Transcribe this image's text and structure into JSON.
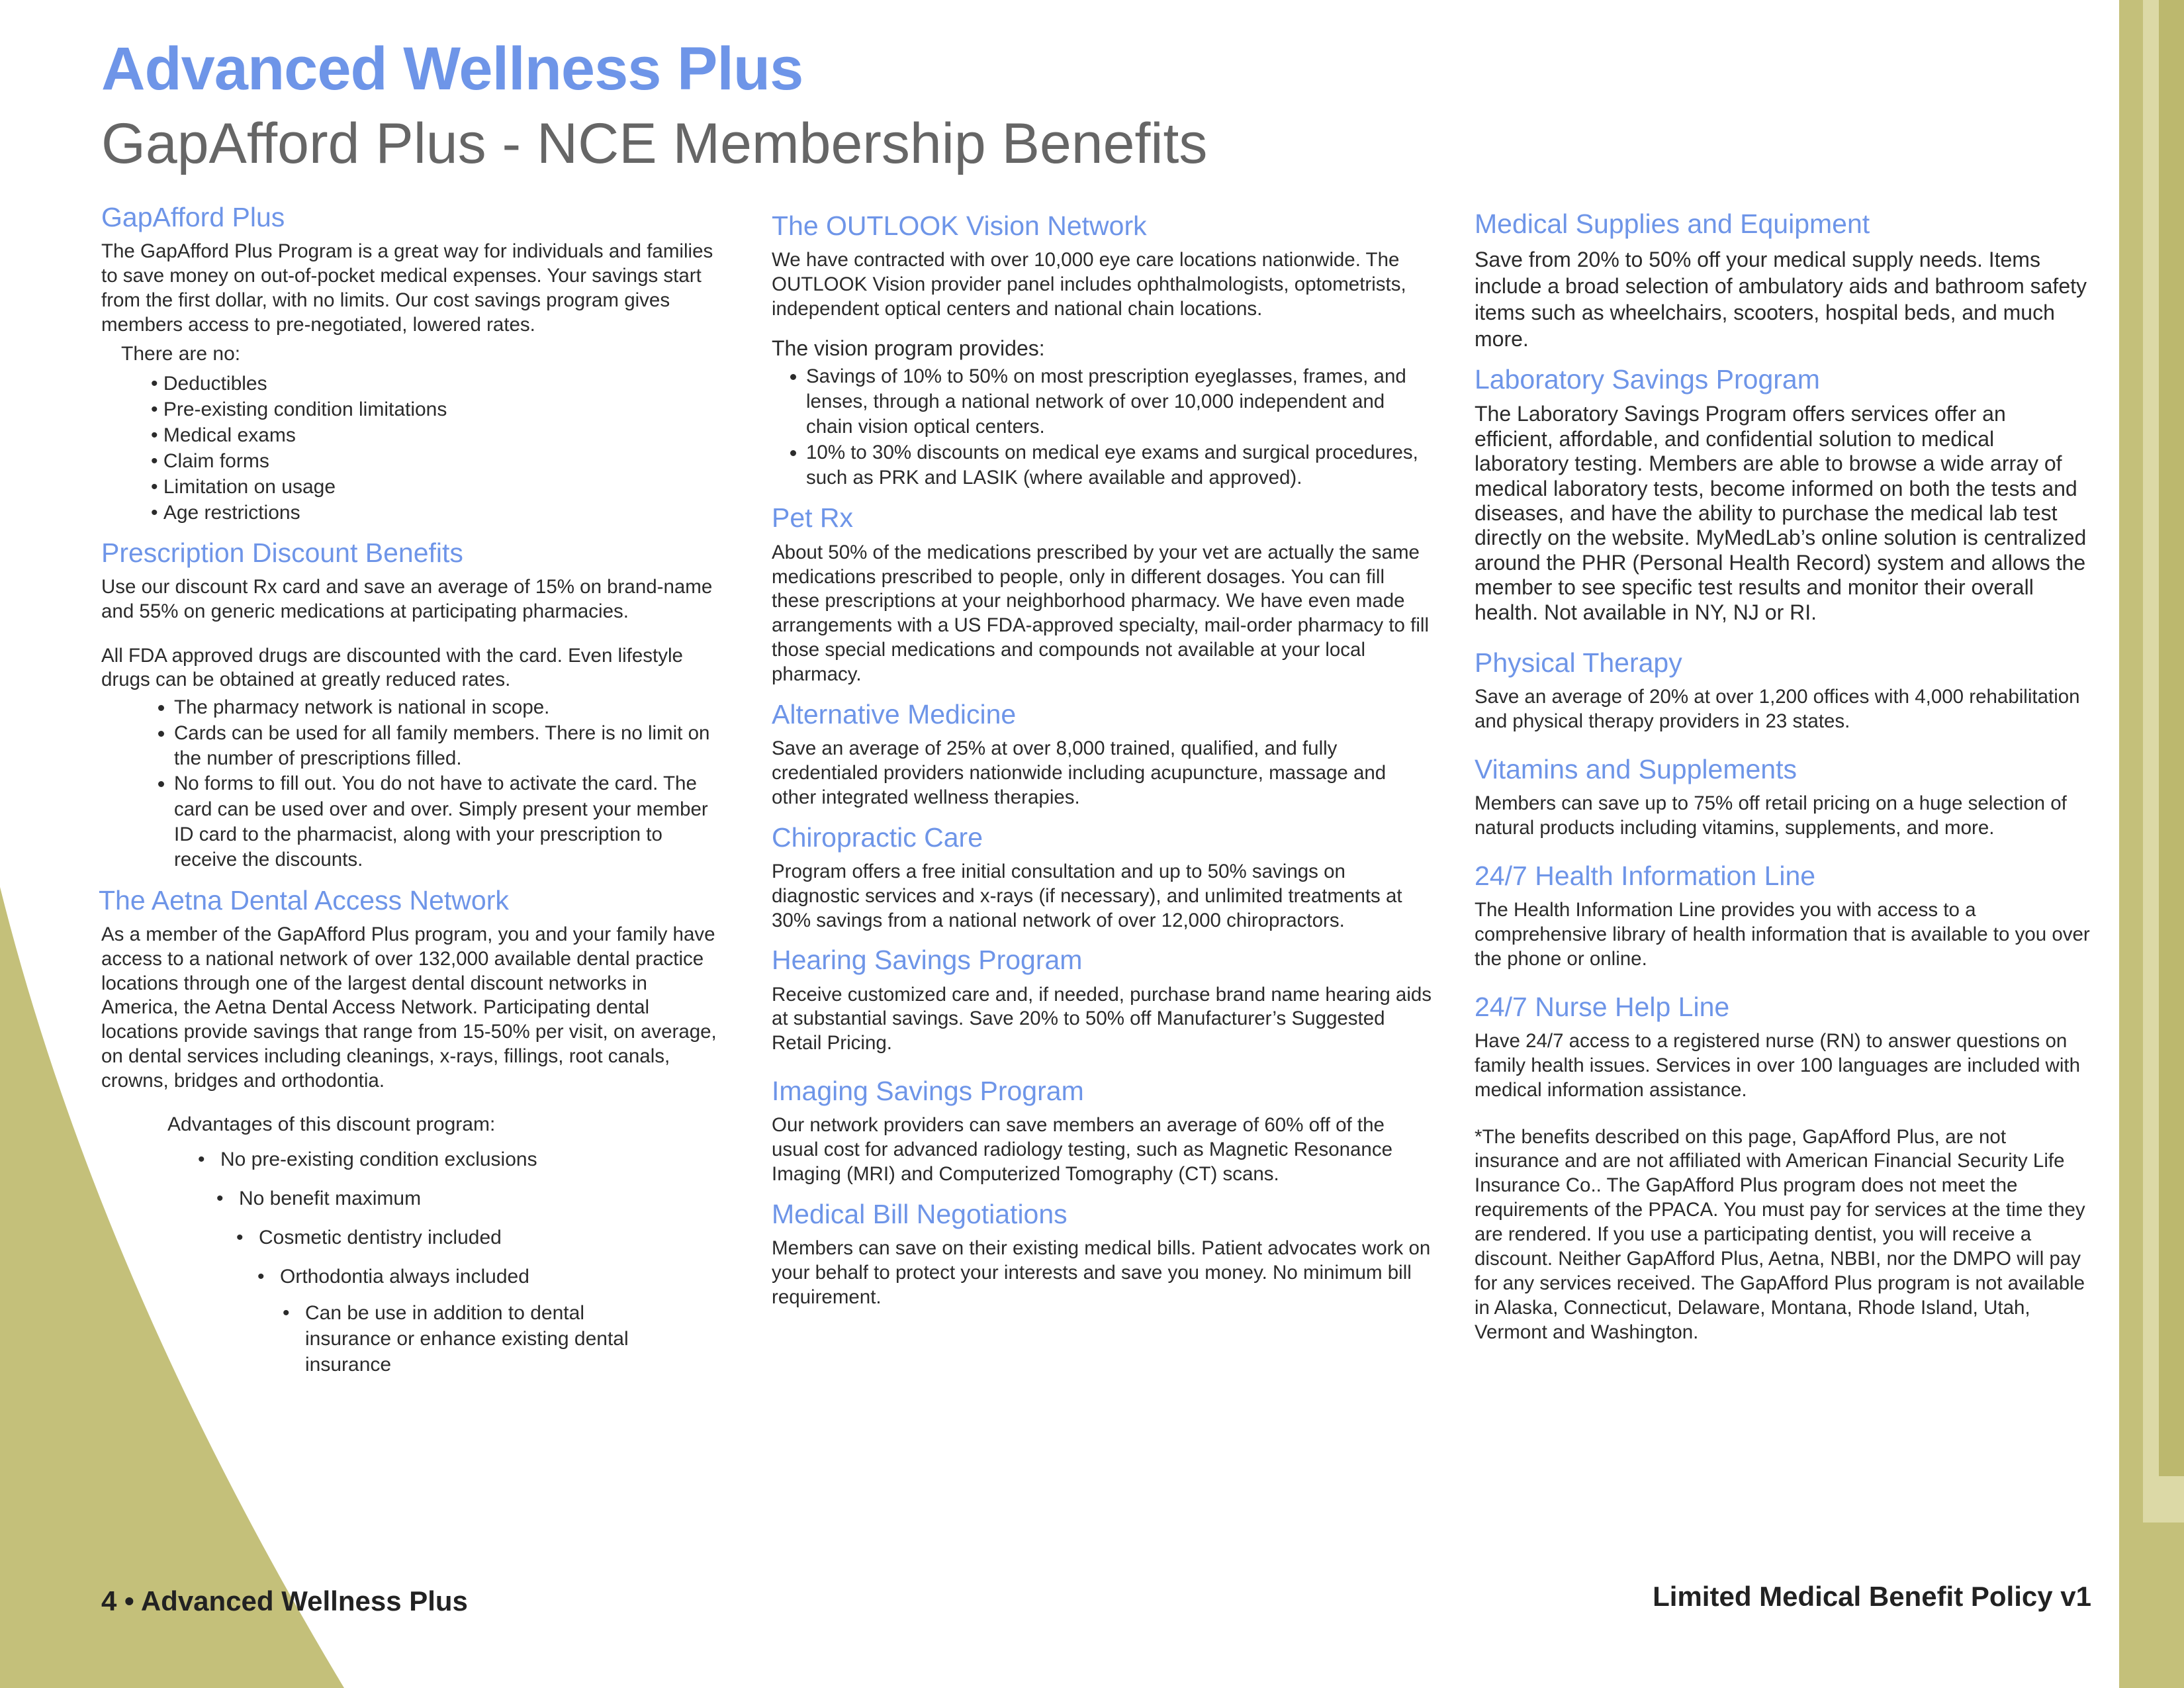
{
  "header": {
    "brand": "Advanced Wellness Plus",
    "title": "GapAfford Plus - NCE Membership Benefits"
  },
  "col1": {
    "gapafford": {
      "heading": "GapAfford Plus",
      "body": "The GapAfford Plus Program is a great way for individuals and families to save money on out-of-pocket medical expenses. Your savings start from the first dollar, with no limits. Our cost savings program gives members access to pre-negotiated, lowered rates.",
      "no_intro": "There are no:",
      "no_items": [
        "Deductibles",
        "Pre-existing condition limitations",
        "Medical exams",
        "Claim forms",
        "Limitation on usage",
        "Age restrictions"
      ]
    },
    "rx": {
      "heading": "Prescription Discount Benefits",
      "body1": "Use our discount Rx card and save an average of 15% on brand-name and 55% on generic medications at participating pharmacies.",
      "body2": "All FDA approved drugs are discounted with the card. Even lifestyle drugs can be obtained at greatly reduced rates.",
      "items": [
        "The pharmacy network is national in scope.",
        "Cards can be used for all family members. There is no limit on the number of prescriptions filled.",
        "No forms to fill out. You do not have to activate the card. The card can be used over and over. Simply present your member ID card to the pharmacist, along with your prescription to receive the discounts."
      ]
    },
    "dental": {
      "heading": "The Aetna Dental Access Network",
      "body": "As a member of the GapAfford Plus program, you and your family have access to a national network of over 132,000 available dental practice locations through one of the largest dental discount networks in America, the Aetna Dental Access Network. Participating dental locations provide savings that range from 15-50% per visit, on average, on dental services including cleanings, x-rays, fillings, root canals, crowns, bridges and orthodontia.",
      "adv_title": "Advantages of this discount program:",
      "adv_items": [
        "No pre-existing condition exclusions",
        "No benefit maximum",
        "Cosmetic dentistry included",
        "Orthodontia always included",
        "Can be use in addition to dental insurance or enhance existing dental insurance"
      ]
    }
  },
  "col2": {
    "vision": {
      "heading": "The OUTLOOK Vision Network",
      "body": "We have contracted with over 10,000 eye care locations nationwide. The OUTLOOK Vision provider panel includes ophthalmologists, optometrists, independent optical centers and national chain locations.",
      "intro": "The vision program provides:",
      "items": [
        "Savings of 10% to 50% on most prescription eyeglasses, frames, and lenses, through a national network of over 10,000 independent and chain vision optical centers.",
        "10% to 30% discounts on medical eye exams and surgical procedures, such as PRK and LASIK (where available and approved)."
      ]
    },
    "pet": {
      "heading": "Pet Rx",
      "body": "About 50% of the medications prescribed by your vet are actually the same medications prescribed to people, only in different dosages. You can fill these prescriptions at your neighborhood pharmacy. We have even made arrangements with a US FDA-approved specialty, mail-order pharmacy to fill those special medications and compounds not available at your local pharmacy."
    },
    "alt": {
      "heading": "Alternative Medicine",
      "body": "Save an average of 25% at over 8,000 trained, qualified, and fully credentialed providers nationwide including acupuncture, massage and other integrated wellness therapies."
    },
    "chiro": {
      "heading": "Chiropractic Care",
      "body": "Program offers a free initial consultation and up to 50% savings on diagnostic services and x-rays (if necessary), and unlimited treatments at 30% savings from a national network of over 12,000 chiropractors."
    },
    "hearing": {
      "heading": "Hearing Savings Program",
      "body": "Receive customized care and, if needed, purchase brand name hearing aids at substantial savings. Save 20% to 50% off Manufacturer’s Suggested Retail Pricing."
    },
    "imaging": {
      "heading": "Imaging Savings Program",
      "body": "Our network providers can save members an average of 60% off of the usual cost for advanced radiology testing, such as Magnetic Resonance Imaging (MRI) and Computerized Tomography (CT) scans."
    },
    "bill": {
      "heading": "Medical Bill Negotiations",
      "body": "Members can save on their existing medical bills. Patient advocates work on your behalf to protect your interests and save you money. No minimum bill requirement."
    }
  },
  "col3": {
    "supplies": {
      "heading": "Medical Supplies and Equipment",
      "body": "Save from 20% to 50% off your medical supply needs. Items include a broad selection of ambulatory aids and bathroom safety items such as wheelchairs, scooters, hospital beds, and much more."
    },
    "lab": {
      "heading": "Laboratory Savings Program",
      "body": "The Laboratory Savings Program offers services offer an efficient, affordable, and confidential solution to medical laboratory testing. Members are able to browse a wide array of medical laboratory tests, become informed on both the tests and diseases, and have the ability to purchase the medical lab test directly on the website. MyMedLab’s online solution is centralized around the PHR (Personal Health Record) system and allows the member to see specific test results and monitor their overall health. Not available in NY, NJ or RI."
    },
    "pt": {
      "heading": "Physical Therapy",
      "body": "Save an average of 20% at over 1,200 offices with 4,000 rehabilitation and physical therapy providers in 23 states."
    },
    "vitamins": {
      "heading": "Vitamins and Supplements",
      "body": "Members can save up to 75% off retail pricing on a huge selection of natural products including vitamins, supplements, and more."
    },
    "info": {
      "heading": "24/7 Health Information Line",
      "body": "The Health Information Line provides you with access to a comprehensive library of health information that is available to you over the phone or online."
    },
    "nurse": {
      "heading": "24/7 Nurse Help Line",
      "body": "Have 24/7 access to a registered nurse (RN) to answer questions on family health issues. Services in over 100 languages are included with medical information assistance."
    },
    "disclaimer": "*The benefits described on this page, GapAfford Plus, are not insurance and are not affiliated with American Financial Security Life Insurance Co.. The GapAfford Plus program does not meet the requirements of the PPACA. You must pay for services at the time they are rendered. If you use a participating dentist, you will receive a discount. Neither GapAfford Plus, Aetna, NBBI, nor the DMPO will pay for any services received. The GapAfford Plus program is not available in Alaska, Connecticut, Delaware, Montana, Rhode Island, Utah, Vermont and Washington."
  },
  "footer": {
    "left": "4 • Advanced Wellness Plus",
    "right": "Limited Medical Benefit Policy v1"
  },
  "colors": {
    "accent_blue": "#6e95e8",
    "olive": "#c4c07a"
  }
}
